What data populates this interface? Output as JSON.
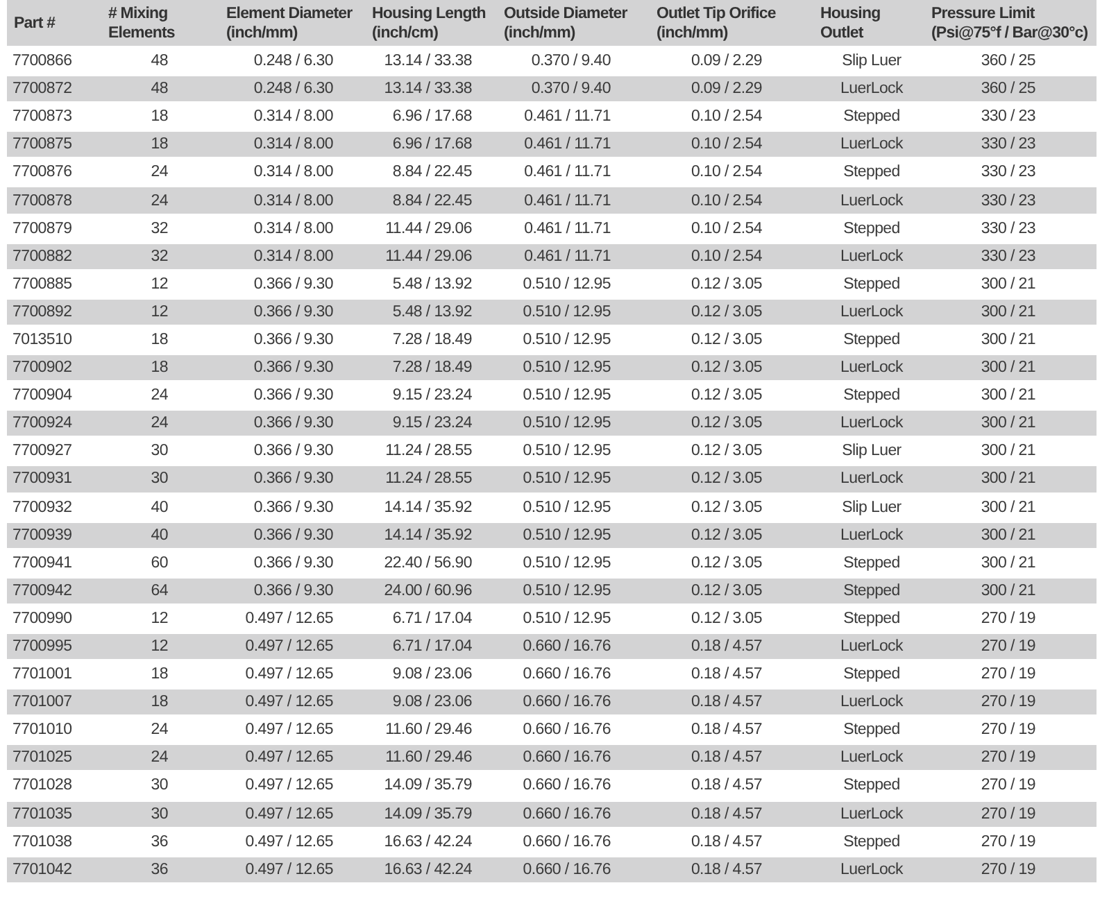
{
  "table": {
    "columns": [
      "Part #",
      "# Mixing\nElements",
      "Element Diameter\n(inch/mm)",
      "Housing Length\n(inch/cm)",
      "Outside Diameter\n(inch/mm)",
      "Outlet Tip Orifice\n(inch/mm)",
      "Housing\nOutlet",
      "Pressure Limit\n(Psi@75°f / Bar@30°c)"
    ],
    "rows": [
      [
        "7700866",
        "48",
        "0.248 / 6.30",
        "13.14 / 33.38",
        "0.370 / 9.40",
        "0.09 / 2.29",
        "Slip Luer",
        "360 / 25"
      ],
      [
        "7700872",
        "48",
        "0.248 / 6.30",
        "13.14 / 33.38",
        "0.370 / 9.40",
        "0.09 / 2.29",
        "LuerLock",
        "360 / 25"
      ],
      [
        "7700873",
        "18",
        "0.314 / 8.00",
        "6.96 / 17.68",
        "0.461 / 11.71",
        "0.10 / 2.54",
        "Stepped",
        "330 / 23"
      ],
      [
        "7700875",
        "18",
        "0.314 / 8.00",
        "6.96 / 17.68",
        "0.461 / 11.71",
        "0.10 / 2.54",
        "LuerLock",
        "330 / 23"
      ],
      [
        "7700876",
        "24",
        "0.314 / 8.00",
        "8.84 / 22.45",
        "0.461 / 11.71",
        "0.10 / 2.54",
        "Stepped",
        "330 / 23"
      ],
      [
        "7700878",
        "24",
        "0.314 / 8.00",
        "8.84 / 22.45",
        "0.461 / 11.71",
        "0.10 / 2.54",
        "LuerLock",
        "330 / 23"
      ],
      [
        "7700879",
        "32",
        "0.314 / 8.00",
        "11.44 / 29.06",
        "0.461 / 11.71",
        "0.10 / 2.54",
        "Stepped",
        "330 / 23"
      ],
      [
        "7700882",
        "32",
        "0.314 / 8.00",
        "11.44 / 29.06",
        "0.461 / 11.71",
        "0.10 / 2.54",
        "LuerLock",
        "330 / 23"
      ],
      [
        "7700885",
        "12",
        "0.366 / 9.30",
        "5.48 / 13.92",
        "0.510 / 12.95",
        "0.12 / 3.05",
        "Stepped",
        "300 / 21"
      ],
      [
        "7700892",
        "12",
        "0.366 / 9.30",
        "5.48 / 13.92",
        "0.510 / 12.95",
        "0.12 / 3.05",
        "LuerLock",
        "300 / 21"
      ],
      [
        "7013510",
        "18",
        "0.366 / 9.30",
        "7.28 / 18.49",
        "0.510 / 12.95",
        "0.12 / 3.05",
        "Stepped",
        "300 / 21"
      ],
      [
        "7700902",
        "18",
        "0.366 / 9.30",
        "7.28 / 18.49",
        "0.510 / 12.95",
        "0.12 / 3.05",
        "LuerLock",
        "300 / 21"
      ],
      [
        "7700904",
        "24",
        "0.366 / 9.30",
        "9.15 / 23.24",
        "0.510 / 12.95",
        "0.12 / 3.05",
        "Stepped",
        "300 / 21"
      ],
      [
        "7700924",
        "24",
        "0.366 / 9.30",
        "9.15 / 23.24",
        "0.510 / 12.95",
        "0.12 / 3.05",
        "LuerLock",
        "300 / 21"
      ],
      [
        "7700927",
        "30",
        "0.366 / 9.30",
        "11.24 / 28.55",
        "0.510 / 12.95",
        "0.12 / 3.05",
        "Slip Luer",
        "300 / 21"
      ],
      [
        "7700931",
        "30",
        "0.366 / 9.30",
        "11.24 / 28.55",
        "0.510 / 12.95",
        "0.12 / 3.05",
        "LuerLock",
        "300 / 21"
      ],
      [
        "7700932",
        "40",
        "0.366 / 9.30",
        "14.14 / 35.92",
        "0.510 / 12.95",
        "0.12 / 3.05",
        "Slip Luer",
        "300 / 21"
      ],
      [
        "7700939",
        "40",
        "0.366 / 9.30",
        "14.14 / 35.92",
        "0.510 / 12.95",
        "0.12 / 3.05",
        "LuerLock",
        "300 / 21"
      ],
      [
        "7700941",
        "60",
        "0.366 / 9.30",
        "22.40 / 56.90",
        "0.510 / 12.95",
        "0.12 / 3.05",
        "Stepped",
        "300 / 21"
      ],
      [
        "7700942",
        "64",
        "0.366 / 9.30",
        "24.00 / 60.96",
        "0.510 / 12.95",
        "0.12 / 3.05",
        "Stepped",
        "300 / 21"
      ],
      [
        "7700990",
        "12",
        "0.497 / 12.65",
        "6.71 / 17.04",
        "0.510 / 12.95",
        "0.12 / 3.05",
        "Stepped",
        "270 / 19"
      ],
      [
        "7700995",
        "12",
        "0.497 / 12.65",
        "6.71 / 17.04",
        "0.660 / 16.76",
        "0.18 / 4.57",
        "LuerLock",
        "270 / 19"
      ],
      [
        "7701001",
        "18",
        "0.497 / 12.65",
        "9.08 / 23.06",
        "0.660 / 16.76",
        "0.18 / 4.57",
        "Stepped",
        "270 / 19"
      ],
      [
        "7701007",
        "18",
        "0.497 / 12.65",
        "9.08 / 23.06",
        "0.660 / 16.76",
        "0.18 / 4.57",
        "LuerLock",
        "270 / 19"
      ],
      [
        "7701010",
        "24",
        "0.497 / 12.65",
        "11.60 / 29.46",
        "0.660 / 16.76",
        "0.18 / 4.57",
        "Stepped",
        "270 / 19"
      ],
      [
        "7701025",
        "24",
        "0.497 / 12.65",
        "11.60 / 29.46",
        "0.660 / 16.76",
        "0.18 / 4.57",
        "LuerLock",
        "270 / 19"
      ],
      [
        "7701028",
        "30",
        "0.497 / 12.65",
        "14.09 / 35.79",
        "0.660 / 16.76",
        "0.18 / 4.57",
        "Stepped",
        "270 / 19"
      ],
      [
        "7701035",
        "30",
        "0.497 / 12.65",
        "14.09 / 35.79",
        "0.660 / 16.76",
        "0.18 / 4.57",
        "LuerLock",
        "270 / 19"
      ],
      [
        "7701038",
        "36",
        "0.497 / 12.65",
        "16.63 / 42.24",
        "0.660 / 16.76",
        "0.18 / 4.57",
        "Stepped",
        "270 / 19"
      ],
      [
        "7701042",
        "36",
        "0.497 / 12.65",
        "16.63 / 42.24",
        "0.660 / 16.76",
        "0.18 / 4.57",
        "LuerLock",
        "270 / 19"
      ]
    ]
  }
}
